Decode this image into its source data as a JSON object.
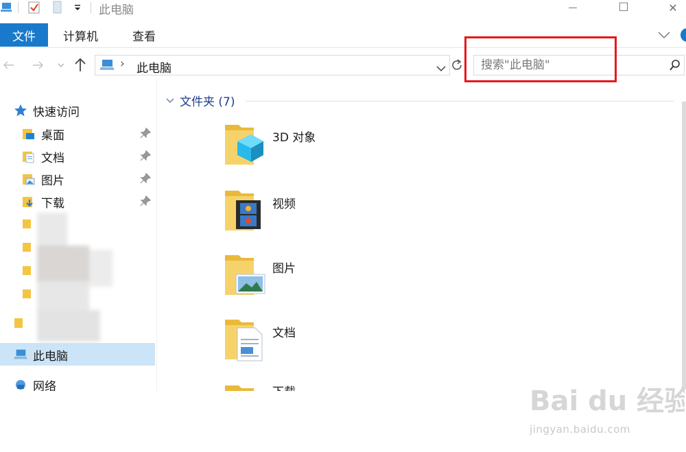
{
  "window": {
    "title": "此电脑",
    "minimize_glyph": "—",
    "maximize_glyph": "☐",
    "close_glyph": "✕"
  },
  "quick_access_toolbar": {
    "icons": [
      "computer-icon",
      "properties-check-icon",
      "new-folder-icon",
      "customize-dropdown-icon"
    ]
  },
  "ribbon": {
    "file_tab": "文件",
    "tabs": [
      "计算机",
      "查看"
    ],
    "accent": "#1979ca"
  },
  "address_bar": {
    "path_label": "此电脑",
    "separator": "›"
  },
  "search": {
    "placeholder": "搜索\"此电脑\"",
    "highlight_color": "#e8161b"
  },
  "nav_pane": {
    "quick_access_label": "快速访问",
    "pinned_items": [
      {
        "label": "桌面",
        "pinned": true
      },
      {
        "label": "文档",
        "pinned": true
      },
      {
        "label": "图片",
        "pinned": true
      },
      {
        "label": "下载",
        "pinned": true
      }
    ],
    "this_pc_label": "此电脑",
    "network_label": "网络"
  },
  "content": {
    "group_header": "文件夹 (7)",
    "folders": [
      {
        "name": "3D 对象",
        "icon": "3d-objects-folder-icon"
      },
      {
        "name": "视频",
        "icon": "videos-folder-icon"
      },
      {
        "name": "图片",
        "icon": "pictures-folder-icon"
      },
      {
        "name": "文档",
        "icon": "documents-folder-icon"
      },
      {
        "name": "下载",
        "icon": "downloads-folder-icon"
      }
    ]
  },
  "watermark": {
    "brand": "Bai du 经验",
    "url": "jingyan.baidu.com"
  }
}
